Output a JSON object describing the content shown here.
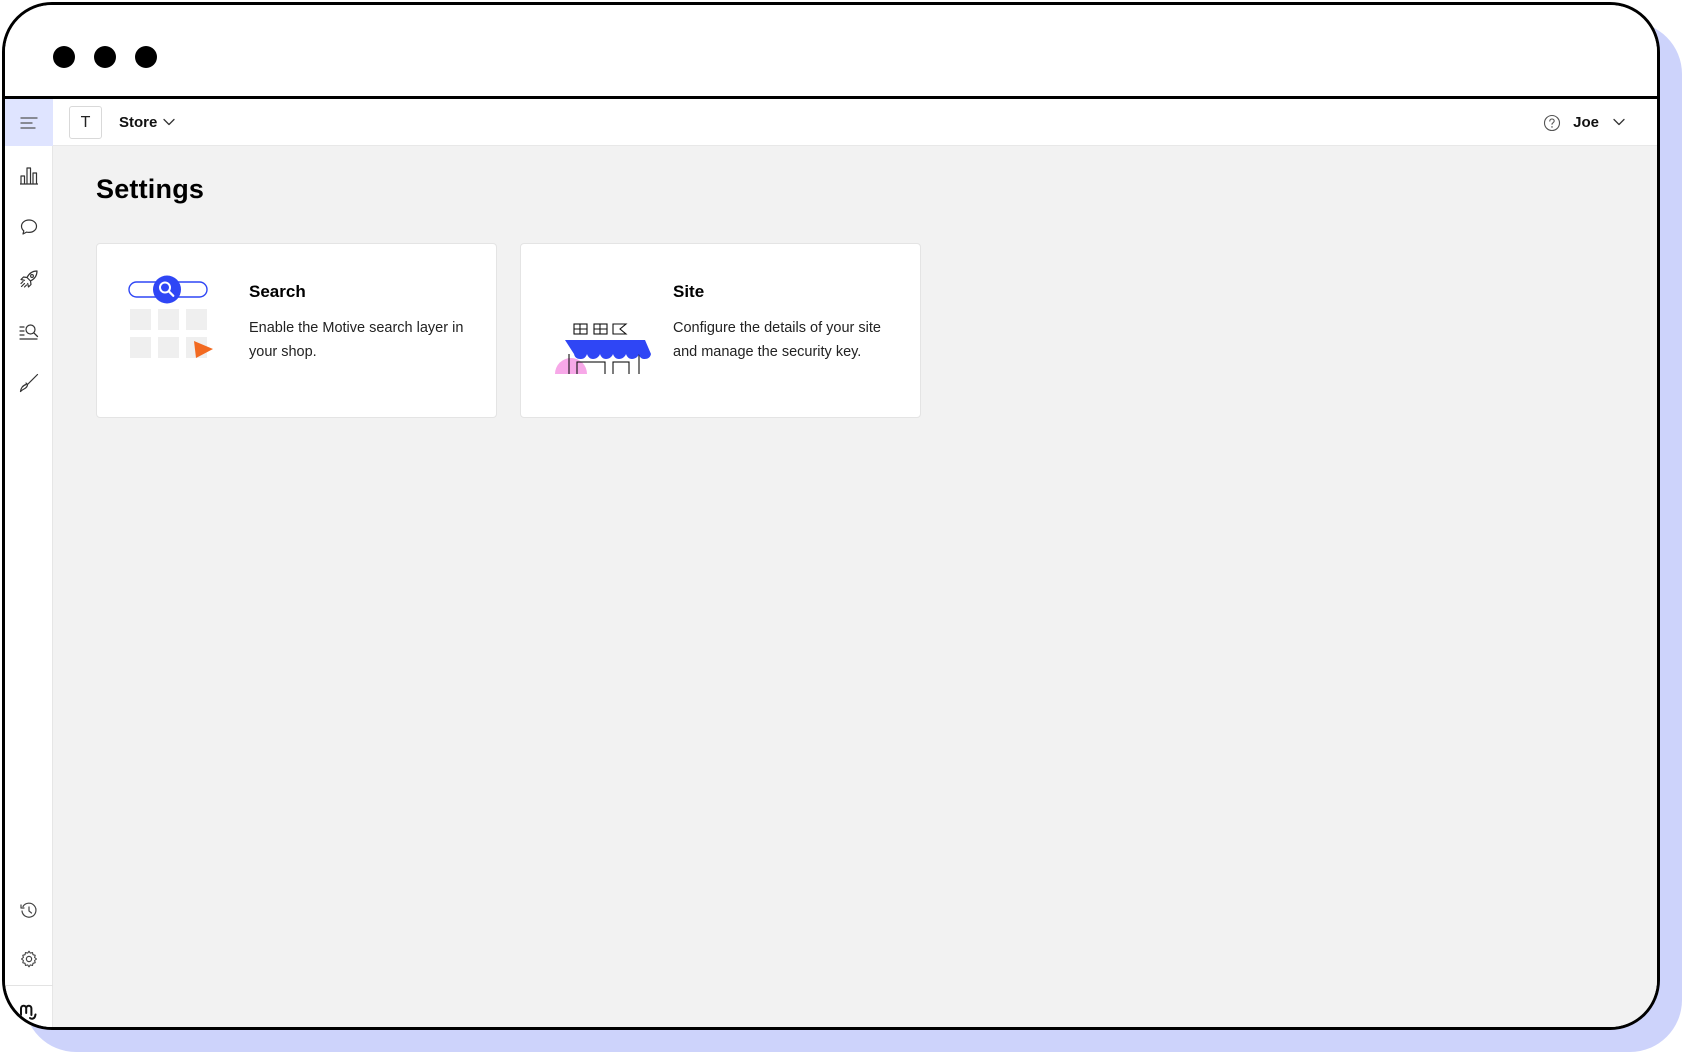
{
  "window": {
    "traffic_lights": [
      "close-dot",
      "minimize-dot",
      "maximize-dot"
    ]
  },
  "sidebar": {
    "menu_icon": "menu-icon",
    "items": [
      {
        "id": "analytics",
        "icon": "bar-chart-icon"
      },
      {
        "id": "messages",
        "icon": "chat-bubble-icon"
      },
      {
        "id": "launch",
        "icon": "rocket-icon"
      },
      {
        "id": "search-insights",
        "icon": "list-search-icon"
      },
      {
        "id": "design",
        "icon": "brush-icon"
      }
    ],
    "bottom_items": [
      {
        "id": "history",
        "icon": "history-icon"
      },
      {
        "id": "settings",
        "icon": "gear-icon"
      }
    ],
    "logo": "motive-logo"
  },
  "topbar": {
    "store_badge": "T",
    "store_label": "Store",
    "help_icon": "help-circle-icon",
    "user_label": "Joe"
  },
  "main": {
    "title": "Settings",
    "cards": [
      {
        "id": "search",
        "title": "Search",
        "description": "Enable the Motive search layer in your shop.",
        "illustration": "search-illustration"
      },
      {
        "id": "site",
        "title": "Site",
        "description": "Configure the details of your site and manage the security key.",
        "illustration": "storefront-illustration"
      }
    ]
  },
  "colors": {
    "accent_blue": "#2f46f5",
    "sidebar_active_bg": "#dfe4ff",
    "content_bg": "#f2f2f2",
    "outer_shadow": "#cdd3fb",
    "orange": "#f26a21",
    "yellow": "#f2b233",
    "pink": "#f7a8e8"
  }
}
